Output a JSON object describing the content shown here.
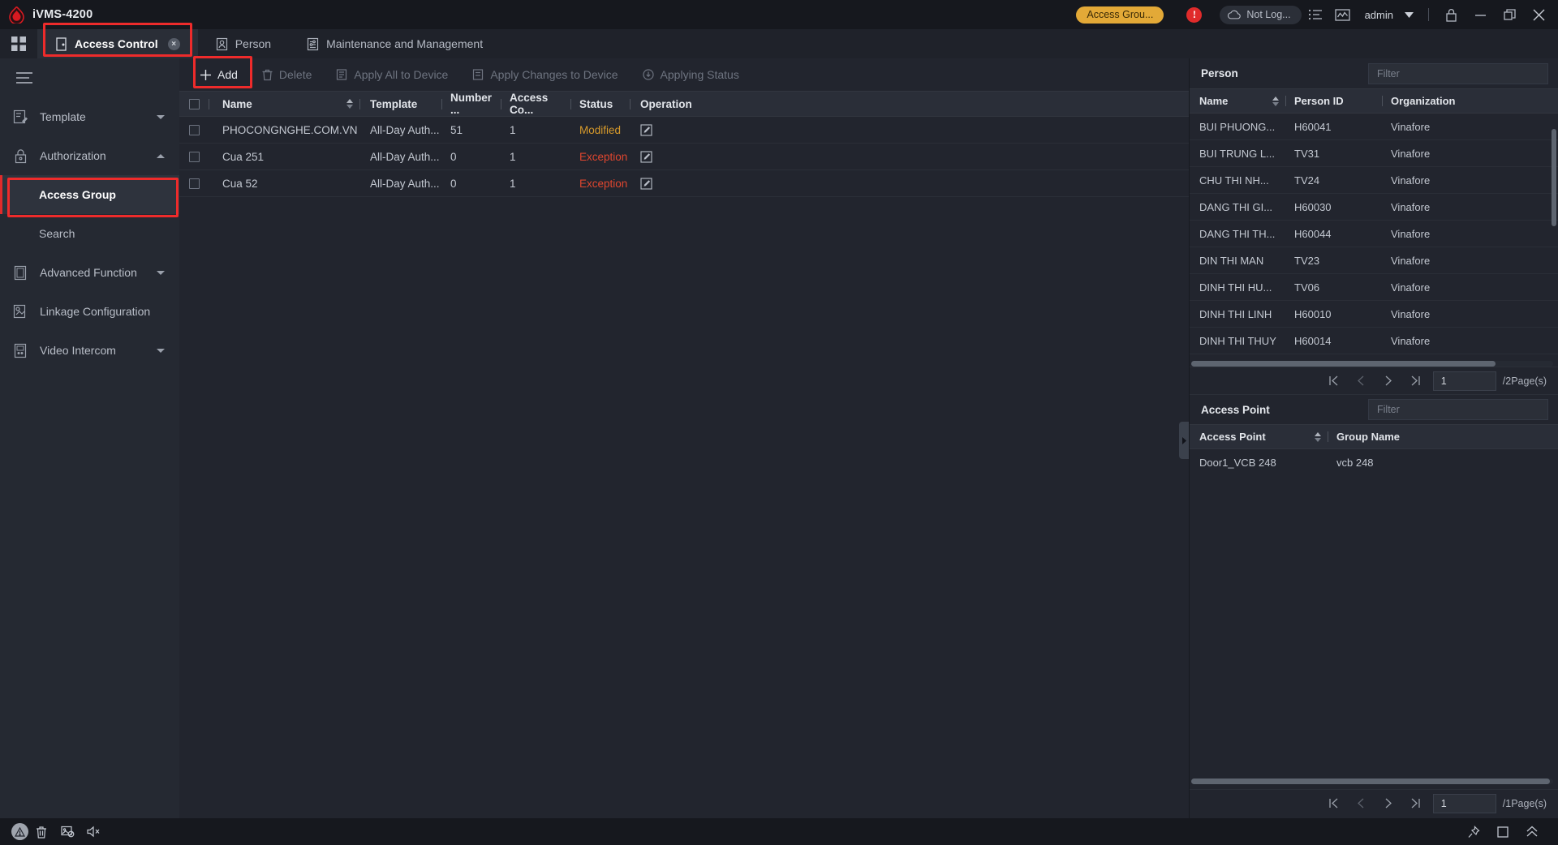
{
  "titlebar": {
    "app_title": "iVMS-4200",
    "logo_icon": "hikvision-drop-logo",
    "badge_label": "Access Grou...",
    "alarm_icon": "alarm-exclamation-icon",
    "alarm_mark": "!",
    "cloud_status": "Not Log...",
    "cloud_icon": "cloud-icon",
    "list_icon": "ordered-list-icon",
    "chart_icon": "chart-monitor-icon",
    "admin_label": "admin",
    "admin_caret_icon": "chevron-down-icon",
    "lock_icon": "lock-icon",
    "minimize_icon": "minimize-icon",
    "restore_icon": "restore-window-icon",
    "close_icon": "close-icon"
  },
  "tabbar": {
    "grid_icon": "app-grid-icon",
    "tabs": [
      {
        "label": "Access Control",
        "icon": "door-icon",
        "active": true,
        "closable": true,
        "close_icon": "tab-close-icon",
        "close_glyph": "×"
      },
      {
        "label": "Person",
        "icon": "person-card-icon",
        "active": false,
        "closable": false
      },
      {
        "label": "Maintenance and Management",
        "icon": "maintenance-icon",
        "active": false,
        "closable": false
      }
    ]
  },
  "sidebar": {
    "hamburger_icon": "hamburger-menu-icon",
    "items": [
      {
        "label": "Template",
        "icon": "template-icon",
        "expandable": true,
        "expanded": false,
        "type": "group"
      },
      {
        "label": "Authorization",
        "icon": "lock-icon",
        "expandable": true,
        "expanded": true,
        "type": "group"
      },
      {
        "label": "Access Group",
        "type": "sub",
        "selected": true
      },
      {
        "label": "Search",
        "type": "sub",
        "selected": false
      },
      {
        "label": "Advanced Function",
        "icon": "advanced-function-icon",
        "expandable": true,
        "expanded": false,
        "type": "group"
      },
      {
        "label": "Linkage Configuration",
        "icon": "linkage-icon",
        "expandable": false,
        "type": "group"
      },
      {
        "label": "Video Intercom",
        "icon": "intercom-icon",
        "expandable": true,
        "expanded": false,
        "type": "group"
      }
    ]
  },
  "toolbar": {
    "actions": [
      {
        "label": "Add",
        "icon": "plus-icon",
        "enabled": true
      },
      {
        "label": "Delete",
        "icon": "trash-icon",
        "enabled": false
      },
      {
        "label": "Apply All to Device",
        "icon": "device-apply-icon",
        "enabled": false
      },
      {
        "label": "Apply Changes to Device",
        "icon": "device-changes-icon",
        "enabled": false
      },
      {
        "label": "Applying Status",
        "icon": "download-status-icon",
        "enabled": false
      }
    ]
  },
  "main_table": {
    "columns": [
      "Name",
      "Template",
      "Number ...",
      "Access Co...",
      "Status",
      "Operation"
    ],
    "sort_icon": "sort-arrows-icon",
    "select_all_icon": "checkbox-unchecked",
    "rows": [
      {
        "checked": false,
        "name": "PHOCONGNGHE.COM.VN",
        "template": "All-Day Auth...",
        "number": "51",
        "access_count": "1",
        "status": "Modified",
        "status_type": "modified",
        "operation_icon": "edit-pencil-icon"
      },
      {
        "checked": false,
        "name": "Cua 251",
        "template": "All-Day Auth...",
        "number": "0",
        "access_count": "1",
        "status": "Exception",
        "status_type": "exception",
        "operation_icon": "edit-pencil-icon"
      },
      {
        "checked": false,
        "name": "Cua 52",
        "template": "All-Day Auth...",
        "number": "0",
        "access_count": "1",
        "status": "Exception",
        "status_type": "exception",
        "operation_icon": "edit-pencil-icon"
      }
    ]
  },
  "person_panel": {
    "title": "Person",
    "filter_placeholder": "Filter",
    "columns": [
      "Name",
      "Person ID",
      "Organization"
    ],
    "sort_icon": "sort-arrows-icon",
    "rows": [
      {
        "name": "BUI PHUONG...",
        "person_id": "H60041",
        "organization": "Vinafore"
      },
      {
        "name": "BUI TRUNG L...",
        "person_id": "TV31",
        "organization": "Vinafore"
      },
      {
        "name": "CHU THI NH...",
        "person_id": "TV24",
        "organization": "Vinafore"
      },
      {
        "name": "DANG THI GI...",
        "person_id": "H60030",
        "organization": "Vinafore"
      },
      {
        "name": "DANG THI TH...",
        "person_id": "H60044",
        "organization": "Vinafore"
      },
      {
        "name": "DIN THI MAN",
        "person_id": "TV23",
        "organization": "Vinafore"
      },
      {
        "name": "DINH THI HU...",
        "person_id": "TV06",
        "organization": "Vinafore"
      },
      {
        "name": "DINH THI LINH",
        "person_id": "H60010",
        "organization": "Vinafore"
      },
      {
        "name": "DINH THI THUY",
        "person_id": "H60014",
        "organization": "Vinafore"
      }
    ],
    "pager": {
      "first_icon": "first-page-icon",
      "prev_icon": "prev-page-icon",
      "next_icon": "next-page-icon",
      "last_icon": "last-page-icon",
      "page_value": "1",
      "total_label": "/2Page(s)"
    }
  },
  "access_point_panel": {
    "title": "Access Point",
    "filter_placeholder": "Filter",
    "columns": [
      "Access Point",
      "Group Name"
    ],
    "sort_icon": "sort-arrows-icon",
    "rows": [
      {
        "access_point": "Door1_VCB 248",
        "group_name": "vcb 248"
      }
    ],
    "pager": {
      "first_icon": "first-page-icon",
      "prev_icon": "prev-page-icon",
      "next_icon": "next-page-icon",
      "last_icon": "last-page-icon",
      "page_value": "1",
      "total_label": "/1Page(s)"
    }
  },
  "statusbar": {
    "left_icons": [
      "alarm-warning-icon",
      "trash-icon",
      "image-disabled-icon",
      "mute-icon"
    ],
    "warn_glyph": "⚠",
    "right_icons": [
      "pin-icon",
      "square-icon",
      "chevrons-up-icon"
    ]
  },
  "annotations": {
    "highlight_color": "#ee2b2b",
    "boxes": [
      "access-control-tab",
      "add-button",
      "access-group-nav"
    ]
  }
}
